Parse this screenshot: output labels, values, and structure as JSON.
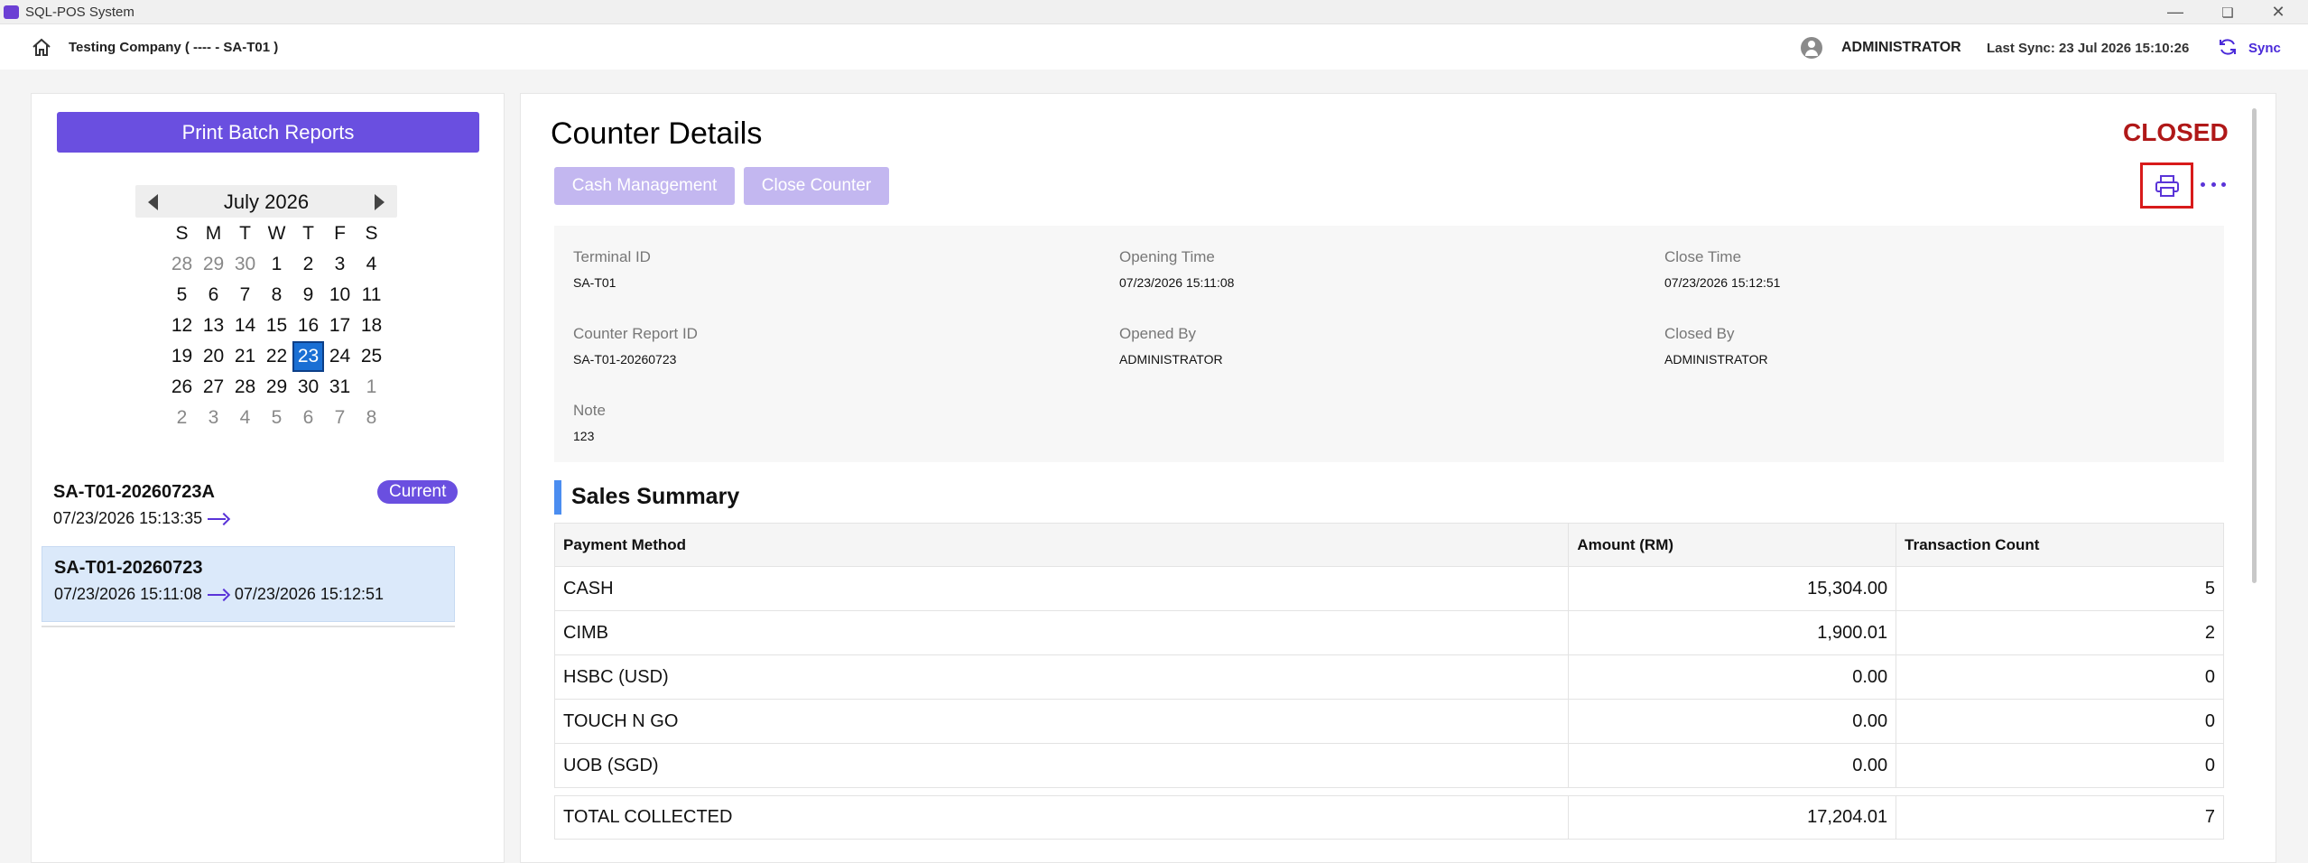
{
  "app": {
    "title": "SQL-POS System"
  },
  "header": {
    "company": "Testing Company ( ---- - SA-T01 )",
    "user": "ADMINISTRATOR",
    "last_sync": "Last Sync: 23 Jul 2026 15:10:26",
    "sync_label": "Sync"
  },
  "sidebar": {
    "print_batch_label": "Print Batch Reports",
    "calendar": {
      "month_label": "July 2026",
      "weekdays": [
        "S",
        "M",
        "T",
        "W",
        "T",
        "F",
        "S"
      ],
      "selected_day": 23,
      "weeks": [
        [
          {
            "d": "28",
            "dim": true
          },
          {
            "d": "29",
            "dim": true
          },
          {
            "d": "30",
            "dim": true
          },
          {
            "d": "1"
          },
          {
            "d": "2"
          },
          {
            "d": "3"
          },
          {
            "d": "4"
          }
        ],
        [
          {
            "d": "5"
          },
          {
            "d": "6"
          },
          {
            "d": "7"
          },
          {
            "d": "8"
          },
          {
            "d": "9"
          },
          {
            "d": "10"
          },
          {
            "d": "11"
          }
        ],
        [
          {
            "d": "12"
          },
          {
            "d": "13"
          },
          {
            "d": "14"
          },
          {
            "d": "15"
          },
          {
            "d": "16"
          },
          {
            "d": "17"
          },
          {
            "d": "18"
          }
        ],
        [
          {
            "d": "19"
          },
          {
            "d": "20"
          },
          {
            "d": "21"
          },
          {
            "d": "22"
          },
          {
            "d": "23",
            "sel": true
          },
          {
            "d": "24"
          },
          {
            "d": "25"
          }
        ],
        [
          {
            "d": "26"
          },
          {
            "d": "27"
          },
          {
            "d": "28"
          },
          {
            "d": "29"
          },
          {
            "d": "30"
          },
          {
            "d": "31"
          },
          {
            "d": "1",
            "dim": true
          }
        ],
        [
          {
            "d": "2",
            "dim": true
          },
          {
            "d": "3",
            "dim": true
          },
          {
            "d": "4",
            "dim": true
          },
          {
            "d": "5",
            "dim": true
          },
          {
            "d": "6",
            "dim": true
          },
          {
            "d": "7",
            "dim": true
          },
          {
            "d": "8",
            "dim": true
          }
        ]
      ]
    },
    "batches": [
      {
        "id": "SA-T01-20260723A",
        "open_time": "07/23/2026 15:13:35",
        "close_time": "",
        "badge": "Current"
      },
      {
        "id": "SA-T01-20260723",
        "open_time": "07/23/2026 15:11:08",
        "close_time": "07/23/2026 15:12:51",
        "badge": ""
      }
    ]
  },
  "main": {
    "title": "Counter Details",
    "status": "CLOSED",
    "status_color": "#b01818",
    "cash_management_label": "Cash Management",
    "close_counter_label": "Close Counter",
    "details": {
      "terminal_id_label": "Terminal ID",
      "terminal_id": "SA-T01",
      "opening_time_label": "Opening Time",
      "opening_time": "07/23/2026 15:11:08",
      "close_time_label": "Close Time",
      "close_time": "07/23/2026 15:12:51",
      "report_id_label": "Counter Report ID",
      "report_id": "SA-T01-20260723",
      "opened_by_label": "Opened By",
      "opened_by": "ADMINISTRATOR",
      "closed_by_label": "Closed By",
      "closed_by": "ADMINISTRATOR",
      "note_label": "Note",
      "note": "123"
    },
    "sales_summary": {
      "title": "Sales Summary",
      "headers": [
        "Payment Method",
        "Amount (RM)",
        "Transaction Count"
      ],
      "rows": [
        {
          "method": "CASH",
          "amount": "15,304.00",
          "count": "5"
        },
        {
          "method": "CIMB",
          "amount": "1,900.01",
          "count": "2"
        },
        {
          "method": "HSBC (USD)",
          "amount": "0.00",
          "count": "0"
        },
        {
          "method": "TOUCH N GO",
          "amount": "0.00",
          "count": "0"
        },
        {
          "method": "UOB (SGD)",
          "amount": "0.00",
          "count": "0"
        }
      ],
      "total": {
        "method": "TOTAL COLLECTED",
        "amount": "17,204.01",
        "count": "7"
      }
    }
  },
  "colors": {
    "accent": "#6a4fe0",
    "accent_disabled": "#c3b7f0",
    "selected_day": "#1a6fd4",
    "highlight_row": "#dbe9fa",
    "section_bar": "#4b8df0"
  },
  "icons": {
    "home": "home-icon",
    "user": "user-avatar-icon",
    "sync": "sync-icon",
    "print": "printer-icon",
    "more": "more-horizontal-icon",
    "arrow": "arrow-right-icon",
    "prev": "chevron-left-icon",
    "next": "chevron-right-icon"
  }
}
